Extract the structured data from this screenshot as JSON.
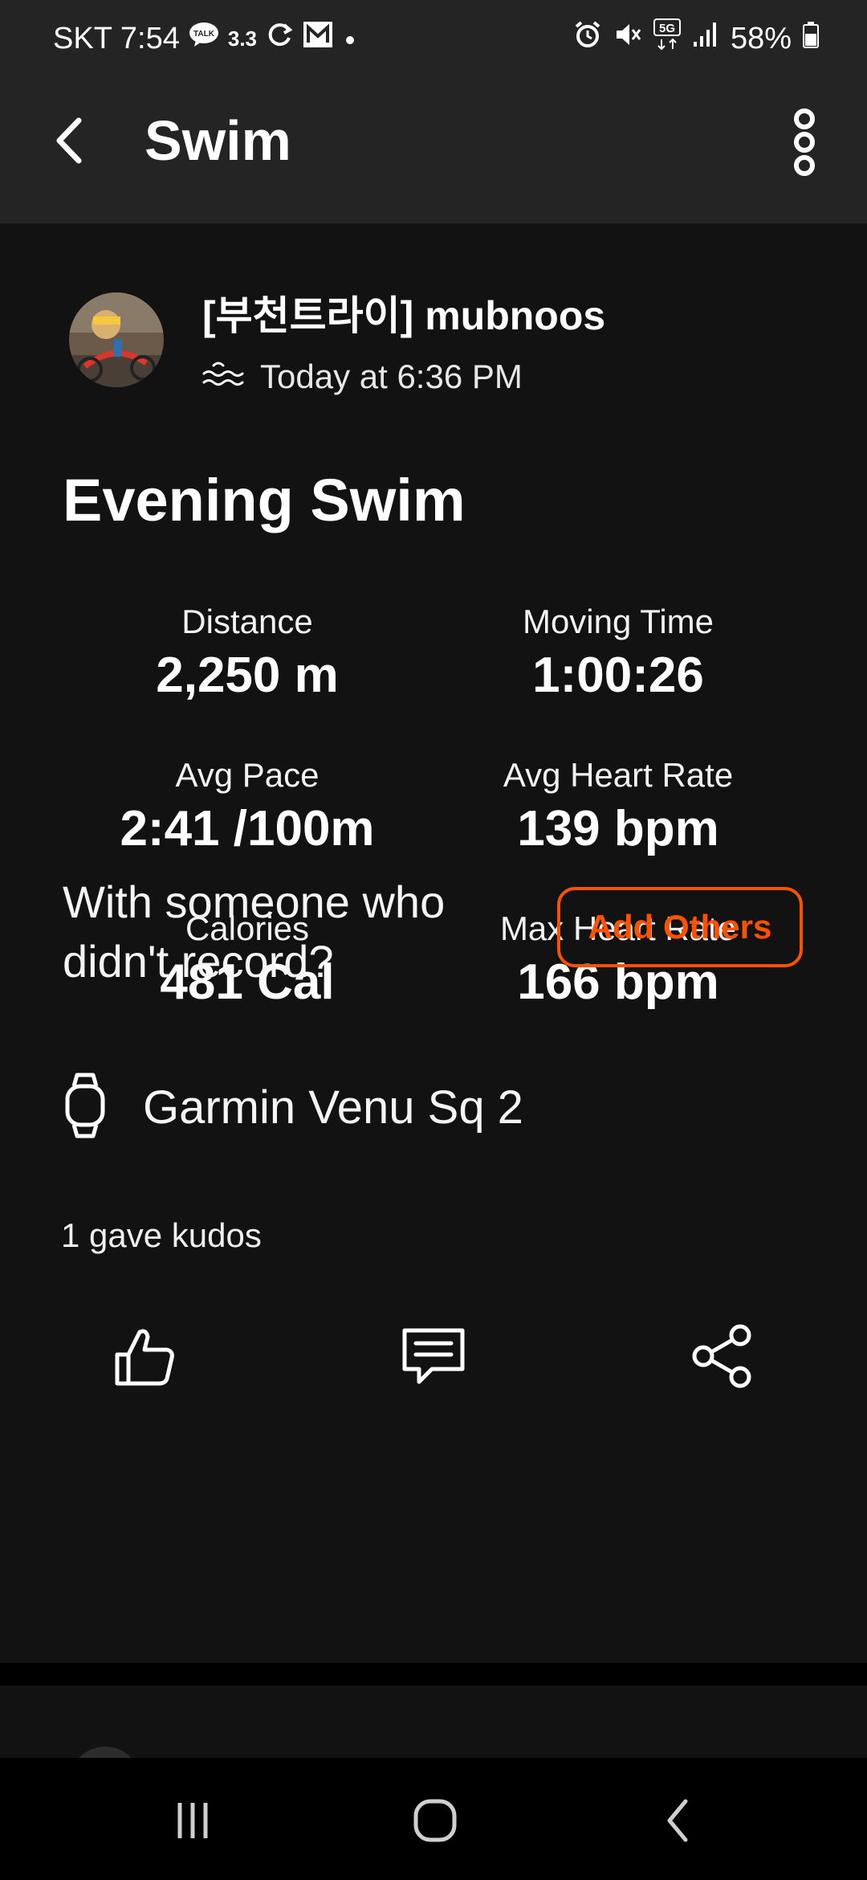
{
  "status_bar": {
    "carrier": "SKT",
    "time": "7:54",
    "data_speed": "3.3",
    "network": "5G",
    "battery": "58%",
    "left_icons": [
      "talk-icon",
      "sync-icon",
      "gmail-icon",
      "dot-icon"
    ],
    "right_icons": [
      "alarm-icon",
      "mute-icon",
      "network-5g-icon",
      "signal-icon",
      "battery-icon"
    ]
  },
  "app_bar": {
    "title": "Swim",
    "back_icon": "chevron-left-icon",
    "menu_icon": "more-vertical-icon"
  },
  "activity": {
    "athlete": "[부천트라이] mubnoos",
    "sport_icon": "swim-icon",
    "time": "Today at 6:36 PM",
    "title": "Evening Swim",
    "stats": [
      {
        "label": "Distance",
        "value": "2,250 m"
      },
      {
        "label": "Moving Time",
        "value": "1:00:26"
      },
      {
        "label": "Avg Pace",
        "value": "2:41 /100m"
      },
      {
        "label": "Avg Heart Rate",
        "value": "139 bpm"
      },
      {
        "label": "Calories",
        "value": "481 Cal"
      },
      {
        "label": "Max Heart Rate",
        "value": "166 bpm"
      }
    ]
  },
  "add_others": {
    "prompt": "With someone who didn't record?",
    "button": "Add Others"
  },
  "device": {
    "icon": "watch-icon",
    "name": "Garmin Venu Sq 2"
  },
  "social": {
    "kudos_text": "1 gave kudos",
    "actions": [
      "kudos-icon",
      "comment-icon",
      "share-icon"
    ]
  },
  "colors": {
    "accent": "#fc5200",
    "background": "#121212",
    "header": "#242424"
  },
  "nav_bar": {
    "buttons": [
      "recent-apps-icon",
      "home-icon",
      "back-icon"
    ]
  }
}
